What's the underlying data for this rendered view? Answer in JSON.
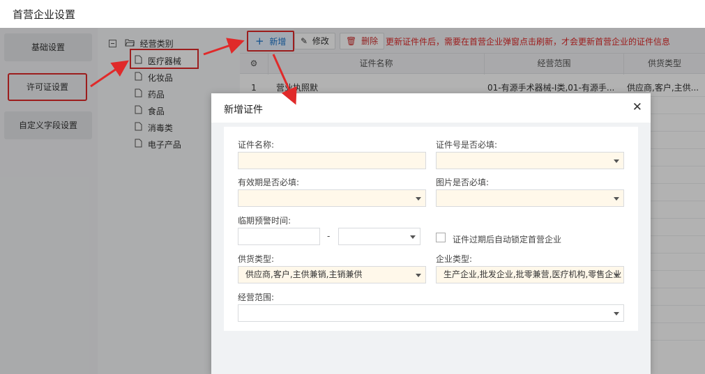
{
  "page": {
    "title": "首营企业设置"
  },
  "left_menu": {
    "items": [
      {
        "label": "基础设置"
      },
      {
        "label": "许可证设置"
      },
      {
        "label": "自定义字段设置"
      }
    ]
  },
  "tree": {
    "root": "经营类别",
    "children": [
      "医疗器械",
      "化妆品",
      "药品",
      "食品",
      "消毒类",
      "电子产品"
    ]
  },
  "toolbar": {
    "add_label": "新增",
    "edit_label": "修改",
    "delete_label": "删除",
    "note": "更新证件件后，需要在首营企业弹窗点击刷新，才会更新首营企业的证件信息"
  },
  "grid": {
    "columns": [
      "证件名称",
      "经营范围",
      "供货类型"
    ],
    "rows": [
      {
        "index": "1",
        "name": "营业执照默",
        "scope": "01-有源手术器械-Ⅰ类,01-有源手...",
        "supply": "供应商,客户,主供..."
      }
    ]
  },
  "modal": {
    "title": "新增证件",
    "close_icon": "close-icon",
    "fields": {
      "cert_name_label": "证件名称:",
      "cert_no_required_label": "证件号是否必填:",
      "validity_required_label": "有效期是否必填:",
      "image_required_label": "图片是否必填:",
      "expiry_warning_label": "临期预警时间:",
      "range_separator": "-",
      "auto_lock_label": "证件过期后自动锁定首营企业",
      "supply_type_label": "供货类型:",
      "supply_type_value": "供应商,客户,主供兼销,主销兼供",
      "company_type_label": "企业类型:",
      "company_type_value": "生产企业,批发企业,批零兼营,医疗机构,零售企业",
      "business_scope_label": "经营范围:"
    }
  },
  "colors": {
    "highlight_red": "#e02a2a",
    "field_bg": "#fff8ea",
    "link_blue": "#1a73c9"
  }
}
